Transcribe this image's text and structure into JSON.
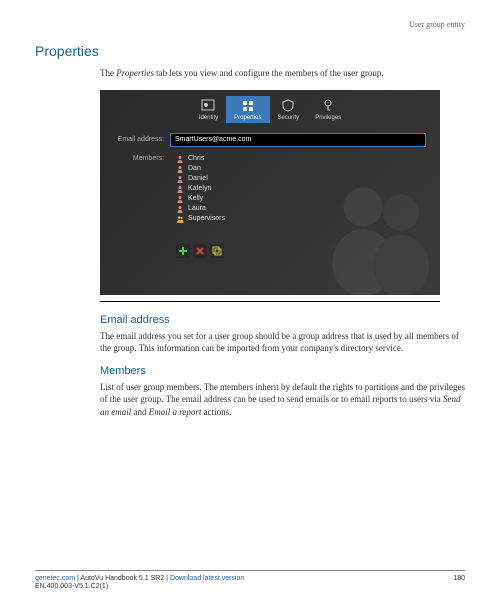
{
  "header": {
    "entity_label": "User group entity"
  },
  "page": {
    "title": "Properties",
    "intro_prefix": "The ",
    "intro_em": "Properties",
    "intro_suffix": " tab lets you view and configure the members of the user group."
  },
  "app": {
    "tabs": [
      {
        "label": "Identity",
        "active": false
      },
      {
        "label": "Properties",
        "active": true
      },
      {
        "label": "Security",
        "active": false
      },
      {
        "label": "Privileges",
        "active": false
      }
    ],
    "email_label": "Email address:",
    "email_value": "SmartUsers@acme.com",
    "members_label": "Members:",
    "members": [
      "Chris",
      "Dan",
      "Daniel",
      "Katelyn",
      "Kelly",
      "Laura",
      "Supervisors"
    ]
  },
  "sections": {
    "email": {
      "title": "Email address",
      "text": "The email address you set for a user group should be a group address that is used by all members of the group. This information can be imported from your company's directory service."
    },
    "members": {
      "title": "Members",
      "text_prefix": "List of user group members. The members inherit by default the rights to partitions and the privileges of the user group. The email address can be used to send emails or to email reports to users via ",
      "text_em1": "Send an email",
      "text_mid": " and ",
      "text_em2": "Email a report",
      "text_suffix": " actions."
    }
  },
  "footer": {
    "brand": "genetec.com",
    "sep": " | ",
    "doc": "AutoVu Handbook 5.1 SR2",
    "download": "Download latest version",
    "page": "180",
    "code": "EN.400.003-V5.1.C2(1)"
  }
}
